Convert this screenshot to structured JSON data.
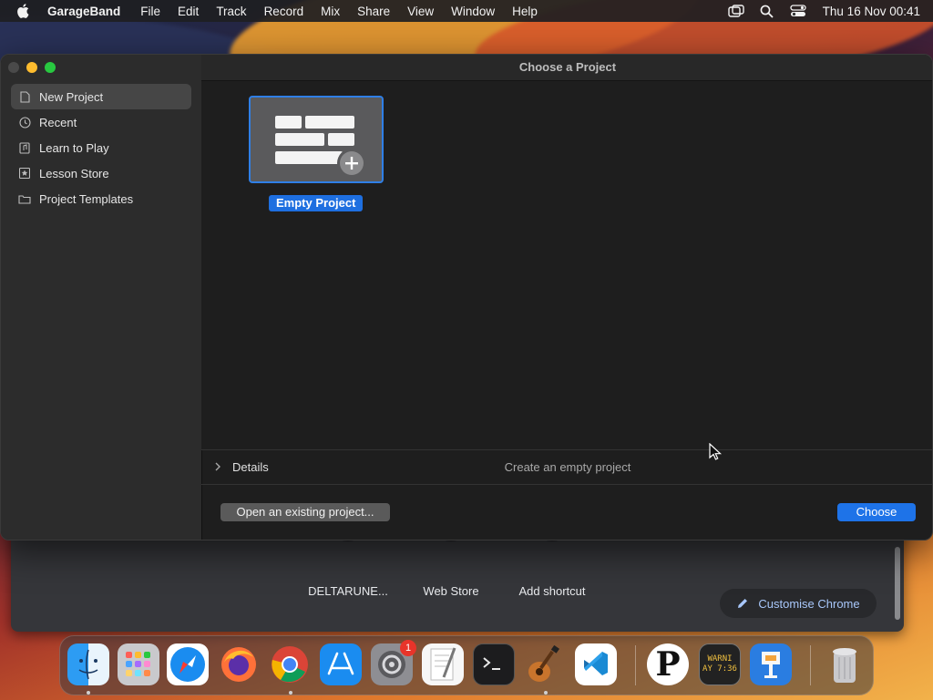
{
  "menubar": {
    "app": "GarageBand",
    "items": [
      "File",
      "Edit",
      "Track",
      "Record",
      "Mix",
      "Share",
      "View",
      "Window",
      "Help"
    ],
    "clock": "Thu 16 Nov  00:41"
  },
  "window": {
    "title": "Choose a Project",
    "sidebar": {
      "items": [
        {
          "label": "New Project",
          "icon": "document-icon",
          "selected": true
        },
        {
          "label": "Recent",
          "icon": "clock-icon"
        },
        {
          "label": "Learn to Play",
          "icon": "music-note-icon"
        },
        {
          "label": "Lesson Store",
          "icon": "star-icon"
        },
        {
          "label": "Project Templates",
          "icon": "folder-icon"
        }
      ]
    },
    "project": {
      "label": "Empty Project"
    },
    "details": {
      "label": "Details",
      "description": "Create an empty project"
    },
    "buttons": {
      "open": "Open an existing project...",
      "choose": "Choose"
    }
  },
  "chrome": {
    "shortcuts": [
      "DELTARUNE...",
      "Web Store",
      "Add shortcut"
    ],
    "customise": "Customise Chrome"
  },
  "dock": {
    "apps": [
      "Finder",
      "Launchpad",
      "Safari",
      "Firefox",
      "Google Chrome",
      "App Store",
      "System Settings",
      "TextEdit",
      "Terminal",
      "GarageBand",
      "Visual Studio Code",
      "P",
      "Console",
      "Keynote",
      "Trash"
    ],
    "system_settings_badge": "1",
    "console_text": [
      "WARNI",
      "AY 7:36"
    ],
    "p_app_letter": "P"
  }
}
